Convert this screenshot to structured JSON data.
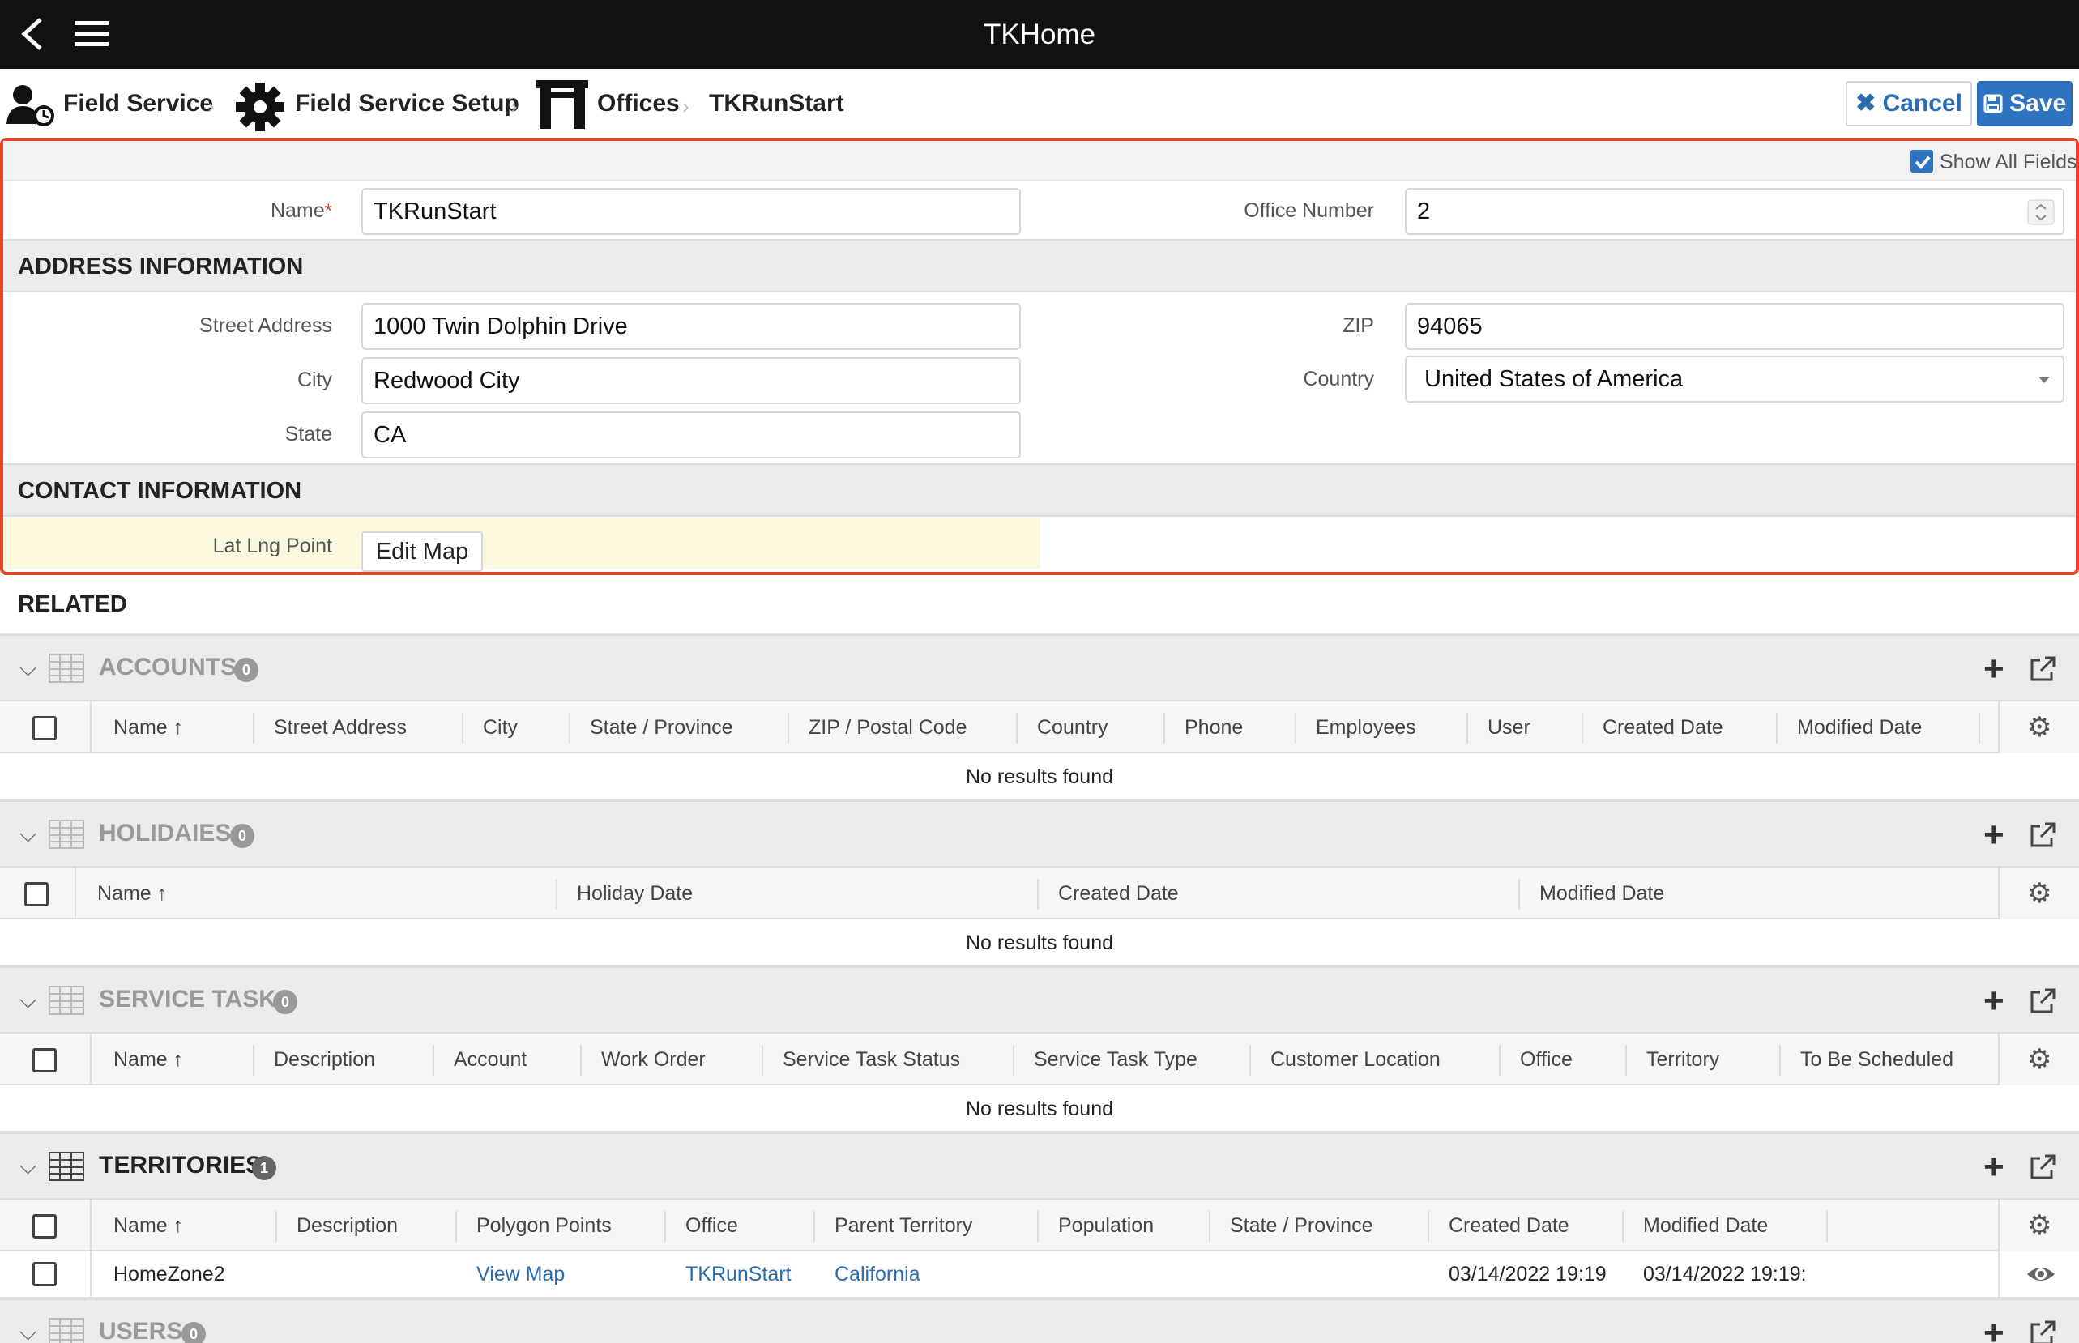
{
  "app": {
    "title": "TKHome"
  },
  "breadcrumb": [
    {
      "label": "Field Service",
      "icon": "user-clock-icon"
    },
    {
      "label": "Field Service Setup",
      "icon": "gear-icon"
    },
    {
      "label": "Offices",
      "icon": "office-gate-icon"
    },
    {
      "label": "TKRunStart"
    }
  ],
  "actions": {
    "cancel": "Cancel",
    "save": "Save"
  },
  "form": {
    "show_all_fields": "Show All Fields",
    "name_label": "Name",
    "name_required": "*",
    "name_value": "TKRunStart",
    "office_number_label": "Office Number",
    "office_number_value": "2",
    "address_section": "ADDRESS INFORMATION",
    "street_label": "Street Address",
    "street_value": "1000 Twin Dolphin Drive",
    "city_label": "City",
    "city_value": "Redwood City",
    "state_label": "State",
    "state_value": "CA",
    "zip_label": "ZIP",
    "zip_value": "94065",
    "country_label": "Country",
    "country_value": "United States of America",
    "contact_section": "CONTACT INFORMATION",
    "latlng_label": "Lat Lng Point",
    "edit_map": "Edit Map"
  },
  "related": {
    "heading": "RELATED",
    "no_results": "No results found",
    "accounts": {
      "title": "ACCOUNTS",
      "count": "0",
      "columns": [
        "Name ↑",
        "Street Address",
        "City",
        "State / Province",
        "ZIP / Postal Code",
        "Country",
        "Phone",
        "Employees",
        "User",
        "Created Date",
        "Modified Date"
      ]
    },
    "holidays": {
      "title": "HOLIDAIES",
      "count": "0",
      "columns": [
        "Name ↑",
        "Holiday Date",
        "Created Date",
        "Modified Date"
      ]
    },
    "service_tasks": {
      "title": "SERVICE TASKS",
      "count": "0",
      "columns": [
        "Name ↑",
        "Description",
        "Account",
        "Work Order",
        "Service Task Status",
        "Service Task Type",
        "Customer Location",
        "Office",
        "Territory",
        "To Be Scheduled"
      ]
    },
    "territories": {
      "title": "TERRITORIES",
      "count": "1",
      "columns": [
        "Name ↑",
        "Description",
        "Polygon Points",
        "Office",
        "Parent Territory",
        "Population",
        "State / Province",
        "Created Date",
        "Modified Date"
      ],
      "rows": [
        {
          "name": "HomeZone2",
          "polygon": "View Map",
          "office": "TKRunStart",
          "parent": "California",
          "created": "03/14/2022 19:19",
          "modified": "03/14/2022 19:19:"
        }
      ]
    },
    "users": {
      "title": "USERS",
      "count": "0"
    }
  }
}
